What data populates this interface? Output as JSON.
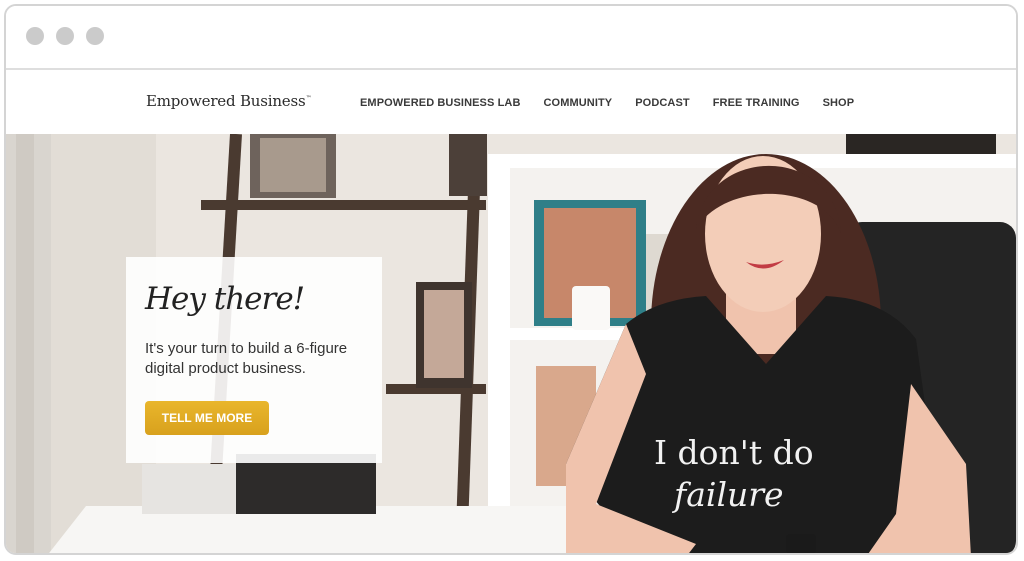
{
  "browser": {
    "dot_colors": [
      "#cbcbcb",
      "#cbcbcb",
      "#cbcbcb"
    ]
  },
  "header": {
    "logo_text": "Empowered Business",
    "logo_mark": "™",
    "nav": [
      {
        "label": "EMPOWERED BUSINESS LAB"
      },
      {
        "label": "COMMUNITY"
      },
      {
        "label": "PODCAST"
      },
      {
        "label": "FREE TRAINING"
      },
      {
        "label": "SHOP"
      }
    ]
  },
  "hero": {
    "heading": "Hey there!",
    "subtext": "It's your turn to build a 6-figure digital product business.",
    "cta_label": "TELL ME MORE",
    "shirt_line1": "I don't do",
    "shirt_line2": "failure",
    "accent_color": "#dcaa22"
  }
}
